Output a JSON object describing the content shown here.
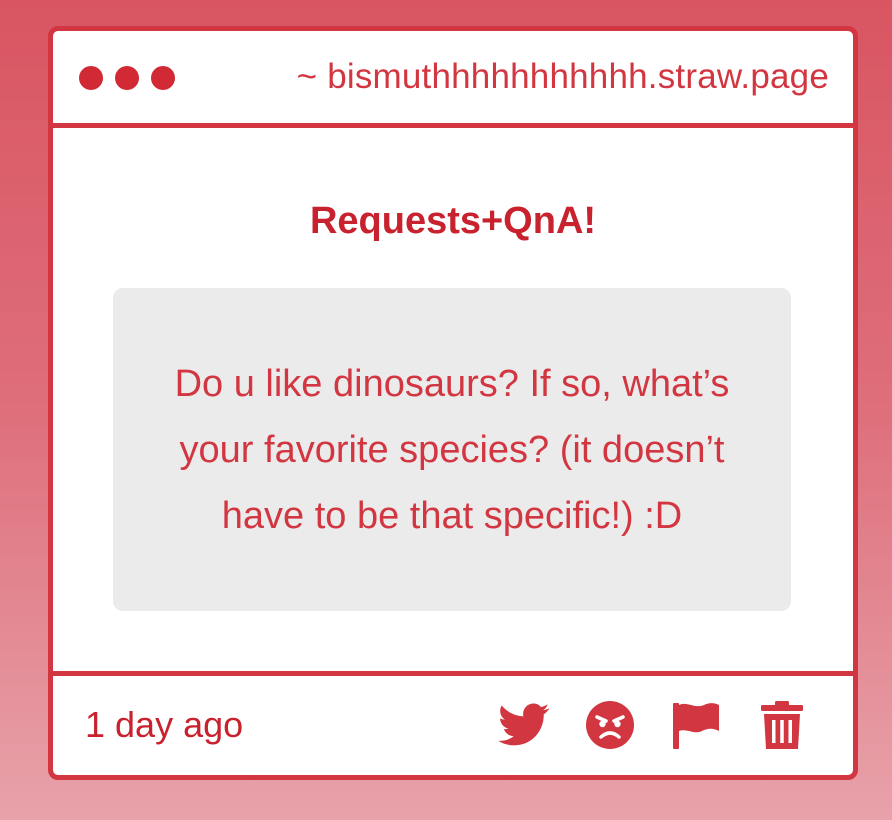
{
  "window": {
    "url": "~ bismuthhhhhhhhhhh.straw.page"
  },
  "post": {
    "title": "Requests+QnA!",
    "question": "Do u like dinosaurs? If so, what’s your favorite species? (it doesn’t have to be that specific!) :D",
    "timestamp": "1 day ago"
  },
  "actions": [
    {
      "icon": "twitter-bird-icon"
    },
    {
      "icon": "angry-face-icon"
    },
    {
      "icon": "flag-icon"
    },
    {
      "icon": "trash-icon"
    }
  ],
  "colors": {
    "accent": "#d23741",
    "accent_dark": "#c8222e",
    "question_background": "#ecebec",
    "page_gradient_top": "#d95562",
    "page_gradient_bottom": "#e8a2aa"
  }
}
